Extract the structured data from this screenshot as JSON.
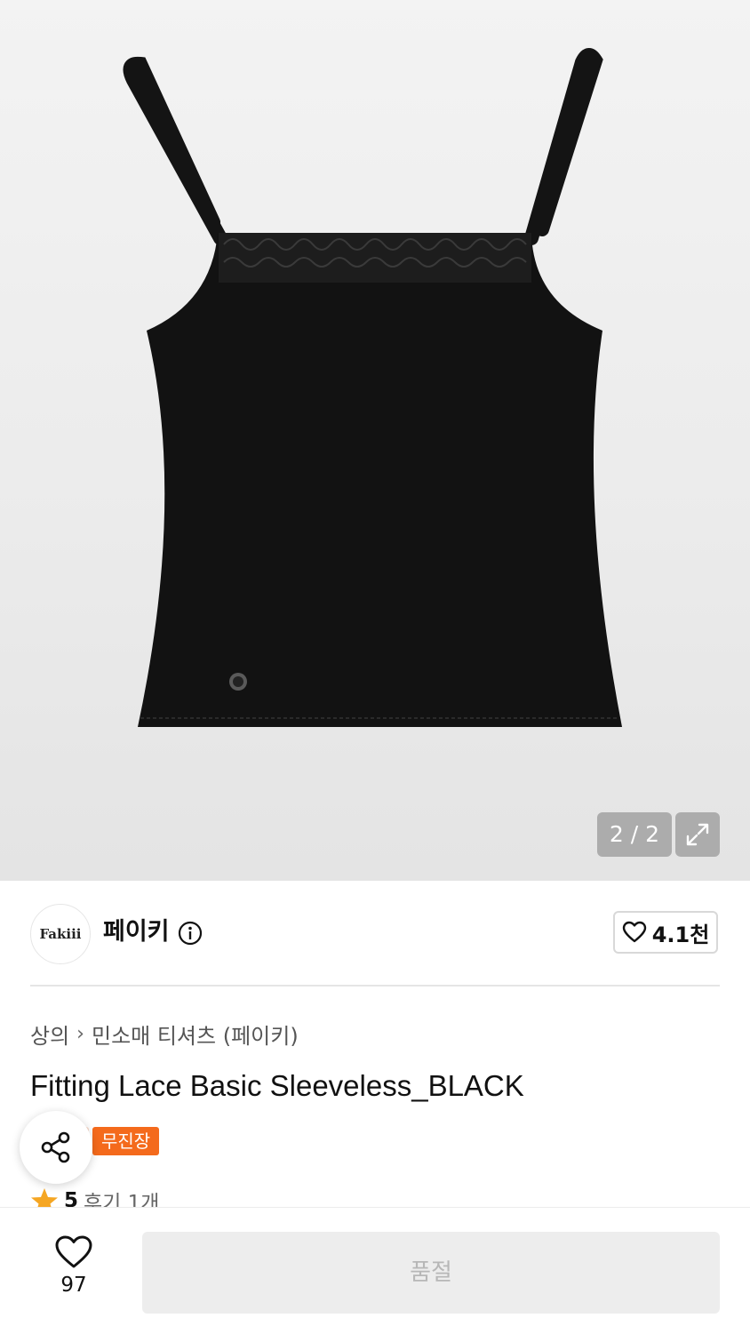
{
  "gallery": {
    "page_indicator": "2 / 2",
    "image_alt": "product-image"
  },
  "brand": {
    "logo_text": "Fakiii",
    "name": "페이키",
    "like_count": "4.1천"
  },
  "breadcrumb": {
    "category": "상의",
    "subcategory": "민소매 티셔츠 (페이키)"
  },
  "product": {
    "title": "Fitting Lace Basic Sleeveless_BLACK",
    "badge": "무진장",
    "rating": "5",
    "reviews": "후기 1개"
  },
  "bottom_bar": {
    "wish_count": "97",
    "purchase_label": "품절"
  },
  "colors": {
    "accent": "#f46a1c",
    "star": "#f5a623"
  }
}
